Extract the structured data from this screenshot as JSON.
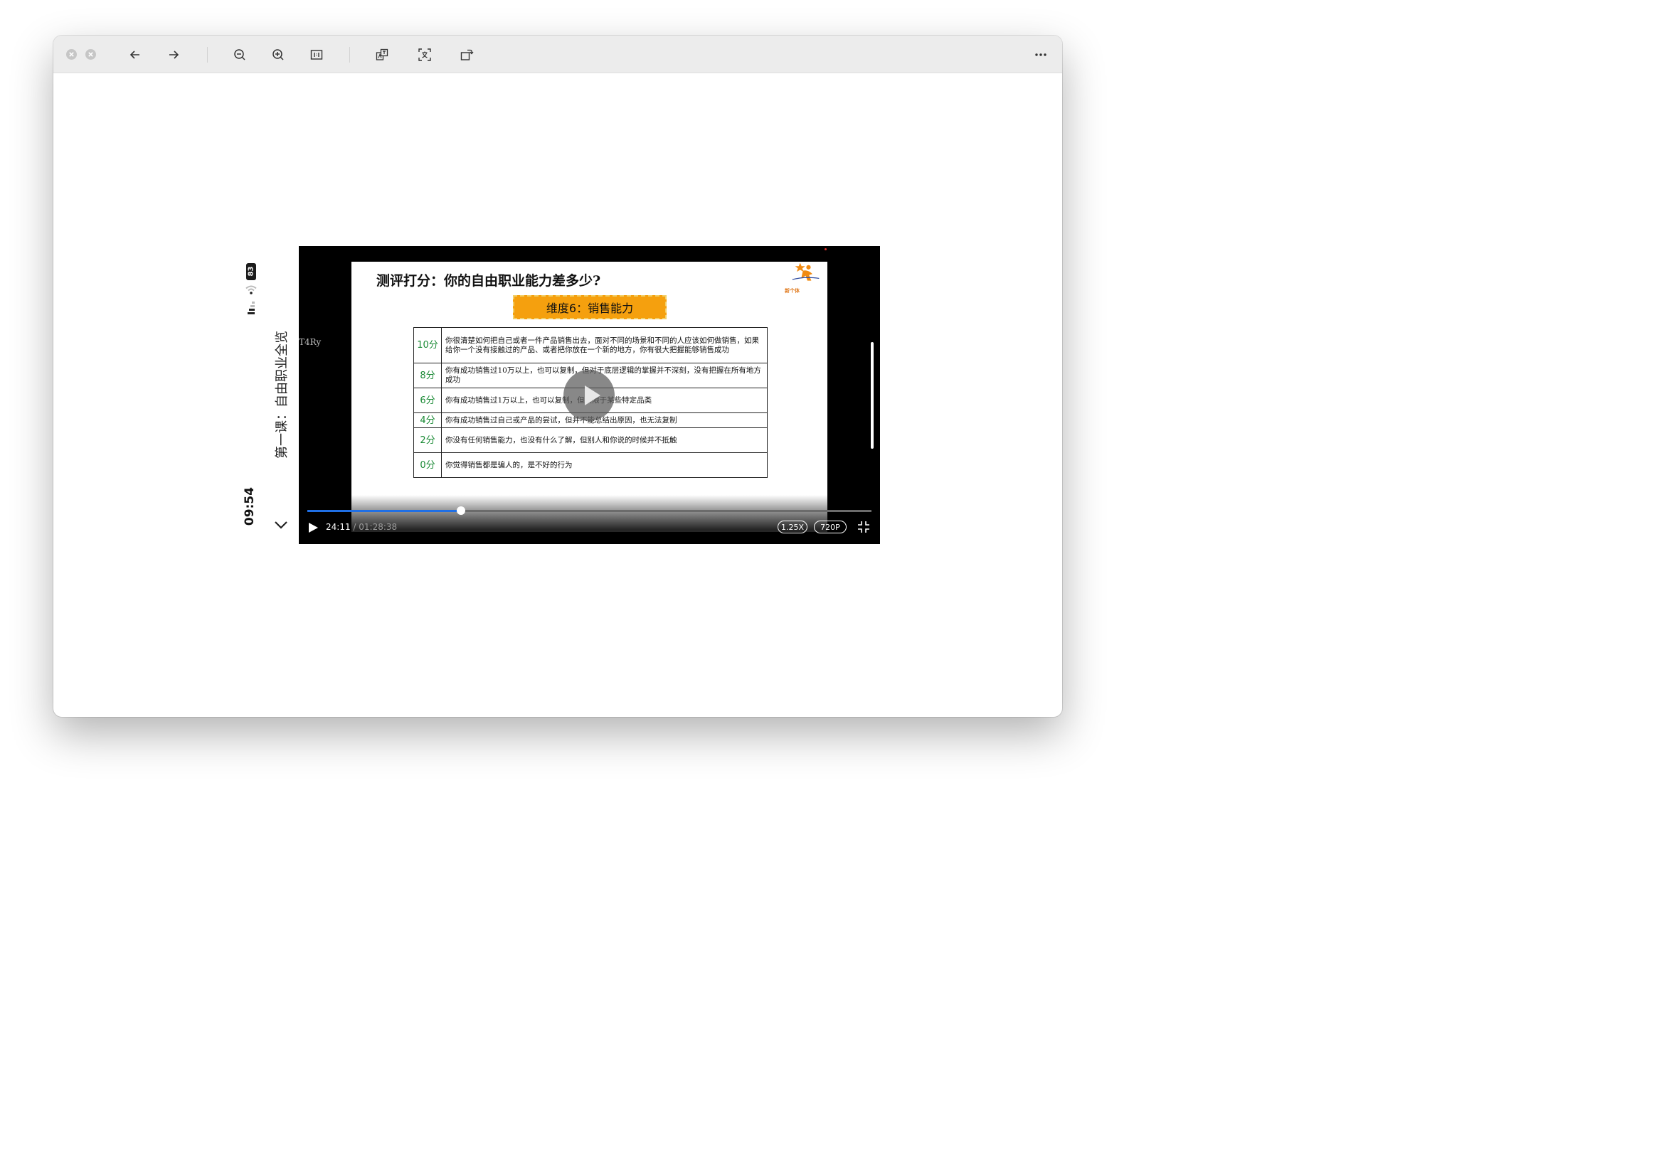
{
  "toolbar": {
    "close": "close-icon",
    "minimize": "minimize-icon",
    "back": "arrow-left-icon",
    "forward": "arrow-right-icon",
    "zoom_out": "zoom-out-icon",
    "zoom_in": "zoom-in-icon",
    "actual_size": "actual-size-icon",
    "translate": "translate-icon",
    "ocr": "text-recognition-icon",
    "rotate": "rotate-icon",
    "more": "more-icon"
  },
  "phone": {
    "battery": "83",
    "clock": "09:54",
    "course_title": "第一课：自由职业全览"
  },
  "video": {
    "watermark": "T4Ry",
    "current_time": "24:11",
    "time_separator": " / ",
    "duration": "01:28:38",
    "progress_fraction": 0.2727,
    "speed": "1.25X",
    "quality": "720P",
    "accent_color": "#1f6fe5"
  },
  "slide": {
    "title": "测评打分：你的自由职业能力差多少?",
    "logo_text": "新个体",
    "dimension_label": "维度6：销售能力",
    "rows": [
      {
        "score": "10分",
        "text": "你很清楚如何把自己或者一件产品销售出去，面对不同的场景和不同的人应该如何做销售，如果给你一个没有接触过的产品、或者把你放在一个新的地方，你有很大把握能够销售成功"
      },
      {
        "score": "8分",
        "text": "你有成功销售过10万以上，也可以复制，但对于底层逻辑的掌握并不深刻，没有把握在所有地方成功"
      },
      {
        "score": "6分",
        "text": "你有成功销售过1万以上，也可以复制，但只限于某些特定品类"
      },
      {
        "score": "4分",
        "text": "你有成功销售过自己或产品的尝试，但并不能总结出原因，也无法复制"
      },
      {
        "score": "2分",
        "text": "你没有任何销售能力，也没有什么了解，但别人和你说的时候并不抵触"
      },
      {
        "score": "0分",
        "text": "你觉得销售都是骗人的，是不好的行为"
      }
    ]
  }
}
